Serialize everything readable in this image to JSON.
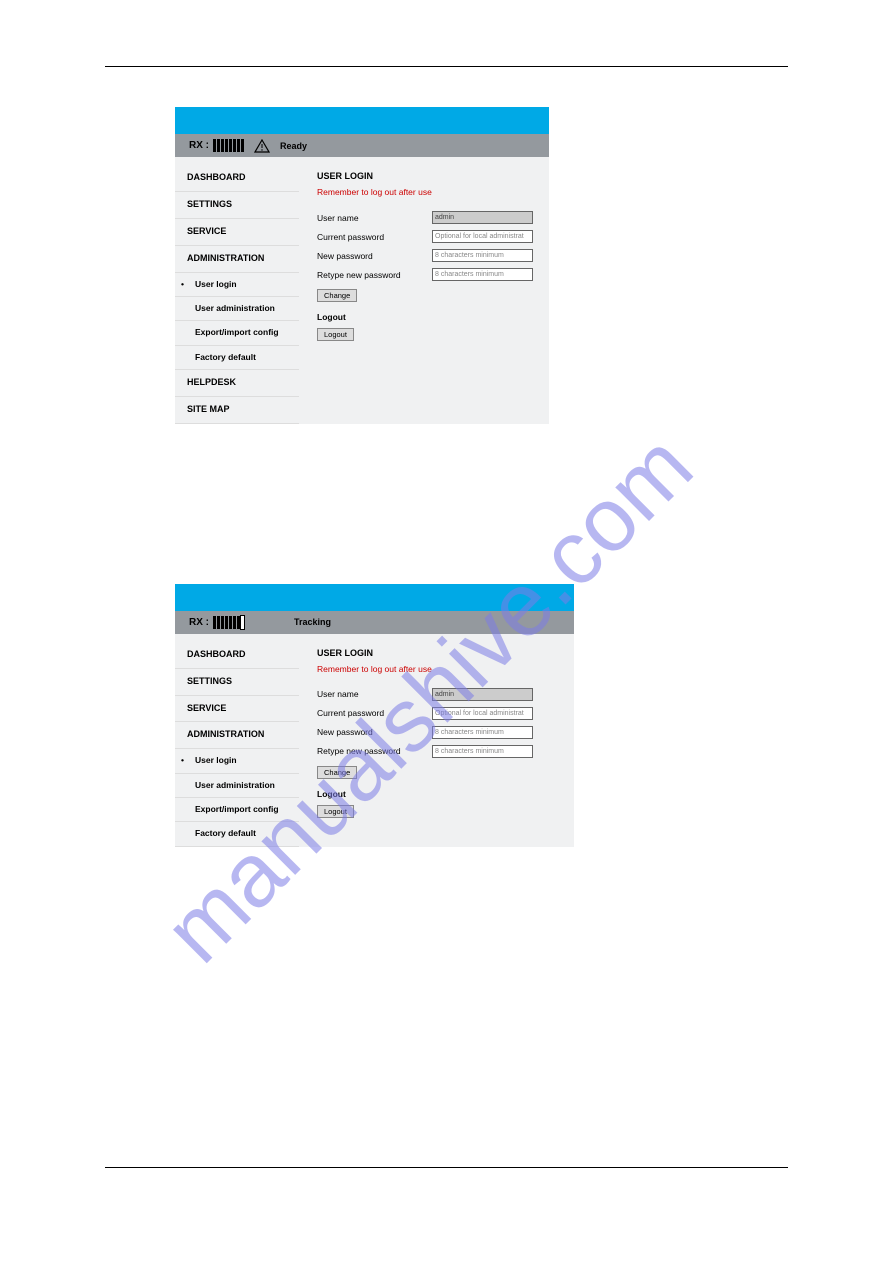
{
  "fig1": {
    "status": {
      "rx_prefix": "RX :",
      "status_text": "Ready"
    },
    "sidebar": {
      "items": [
        {
          "label": "DASHBOARD",
          "type": "nav"
        },
        {
          "label": "SETTINGS",
          "type": "nav"
        },
        {
          "label": "SERVICE",
          "type": "nav"
        },
        {
          "label": "ADMINISTRATION",
          "type": "nav"
        },
        {
          "label": "User login",
          "type": "sub",
          "active": true
        },
        {
          "label": "User administration",
          "type": "sub"
        },
        {
          "label": "Export/import config",
          "type": "sub"
        },
        {
          "label": "Factory default",
          "type": "sub"
        },
        {
          "label": "HELPDESK",
          "type": "nav"
        },
        {
          "label": "SITE MAP",
          "type": "nav"
        }
      ]
    },
    "content": {
      "title": "USER LOGIN",
      "warning": "Remember to log out after use",
      "rows": {
        "username_label": "User name",
        "username_value": "admin",
        "current_label": "Current password",
        "current_placeholder": "Optional for local administrat",
        "newpw_label": "New password",
        "newpw_placeholder": "8 characters minimum",
        "retype_label": "Retype new password",
        "retype_placeholder": "8 characters minimum"
      },
      "change_btn": "Change",
      "logout_section": "Logout",
      "logout_btn": "Logout"
    }
  },
  "fig2": {
    "status": {
      "rx_prefix": "RX :",
      "status_text": "Tracking"
    },
    "sidebar": {
      "items": [
        {
          "label": "DASHBOARD",
          "type": "nav"
        },
        {
          "label": "SETTINGS",
          "type": "nav"
        },
        {
          "label": "SERVICE",
          "type": "nav"
        },
        {
          "label": "ADMINISTRATION",
          "type": "nav"
        },
        {
          "label": "User login",
          "type": "sub",
          "active": true
        },
        {
          "label": "User administration",
          "type": "sub"
        },
        {
          "label": "Export/import config",
          "type": "sub"
        },
        {
          "label": "Factory default",
          "type": "sub"
        }
      ]
    },
    "content": {
      "title": "USER LOGIN",
      "warning": "Remember to log out after use",
      "rows": {
        "username_label": "User name",
        "username_value": "admin",
        "current_label": "Current password",
        "current_placeholder": "Optional for local administrat",
        "newpw_label": "New password",
        "newpw_placeholder": "8 characters minimum",
        "retype_label": "Retype new password",
        "retype_placeholder": "8 characters minimum"
      },
      "change_btn": "Change",
      "logout_section": "Logout",
      "logout_btn": "Logout"
    }
  },
  "watermark": "manualshive.com"
}
